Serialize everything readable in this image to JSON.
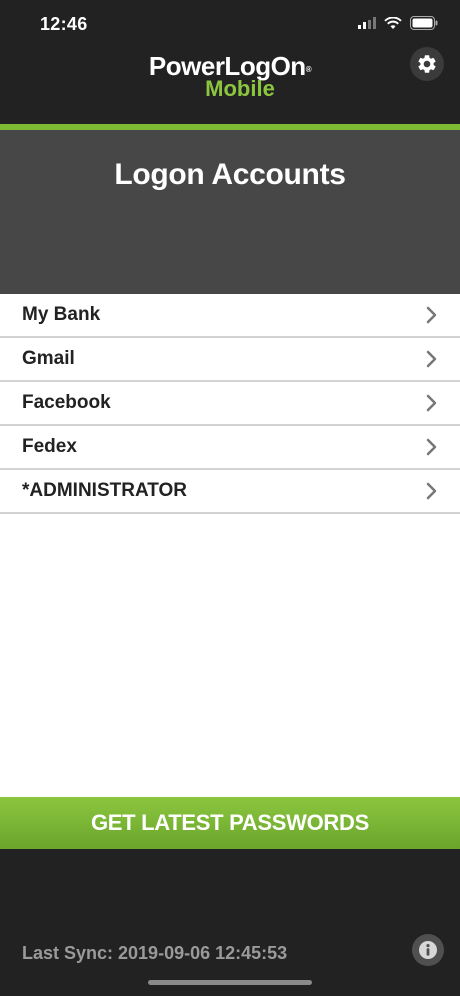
{
  "status_bar": {
    "time": "12:46"
  },
  "header": {
    "logo_main": "PowerLogOn",
    "logo_mark": "®",
    "logo_sub": "Mobile",
    "settings_icon": "gear-icon"
  },
  "page": {
    "title": "Logon Accounts"
  },
  "accounts": [
    {
      "label": "My Bank"
    },
    {
      "label": "Gmail"
    },
    {
      "label": "Facebook"
    },
    {
      "label": "Fedex"
    },
    {
      "label": "*ADMINISTRATOR"
    }
  ],
  "actions": {
    "get_passwords_label": "GET LATEST PASSWORDS"
  },
  "footer": {
    "last_sync": "Last Sync: 2019-09-06 12:45:53",
    "info_icon": "info-icon"
  },
  "colors": {
    "accent": "#7dbb34",
    "header_bg": "#222222",
    "title_band_bg": "#474747"
  }
}
